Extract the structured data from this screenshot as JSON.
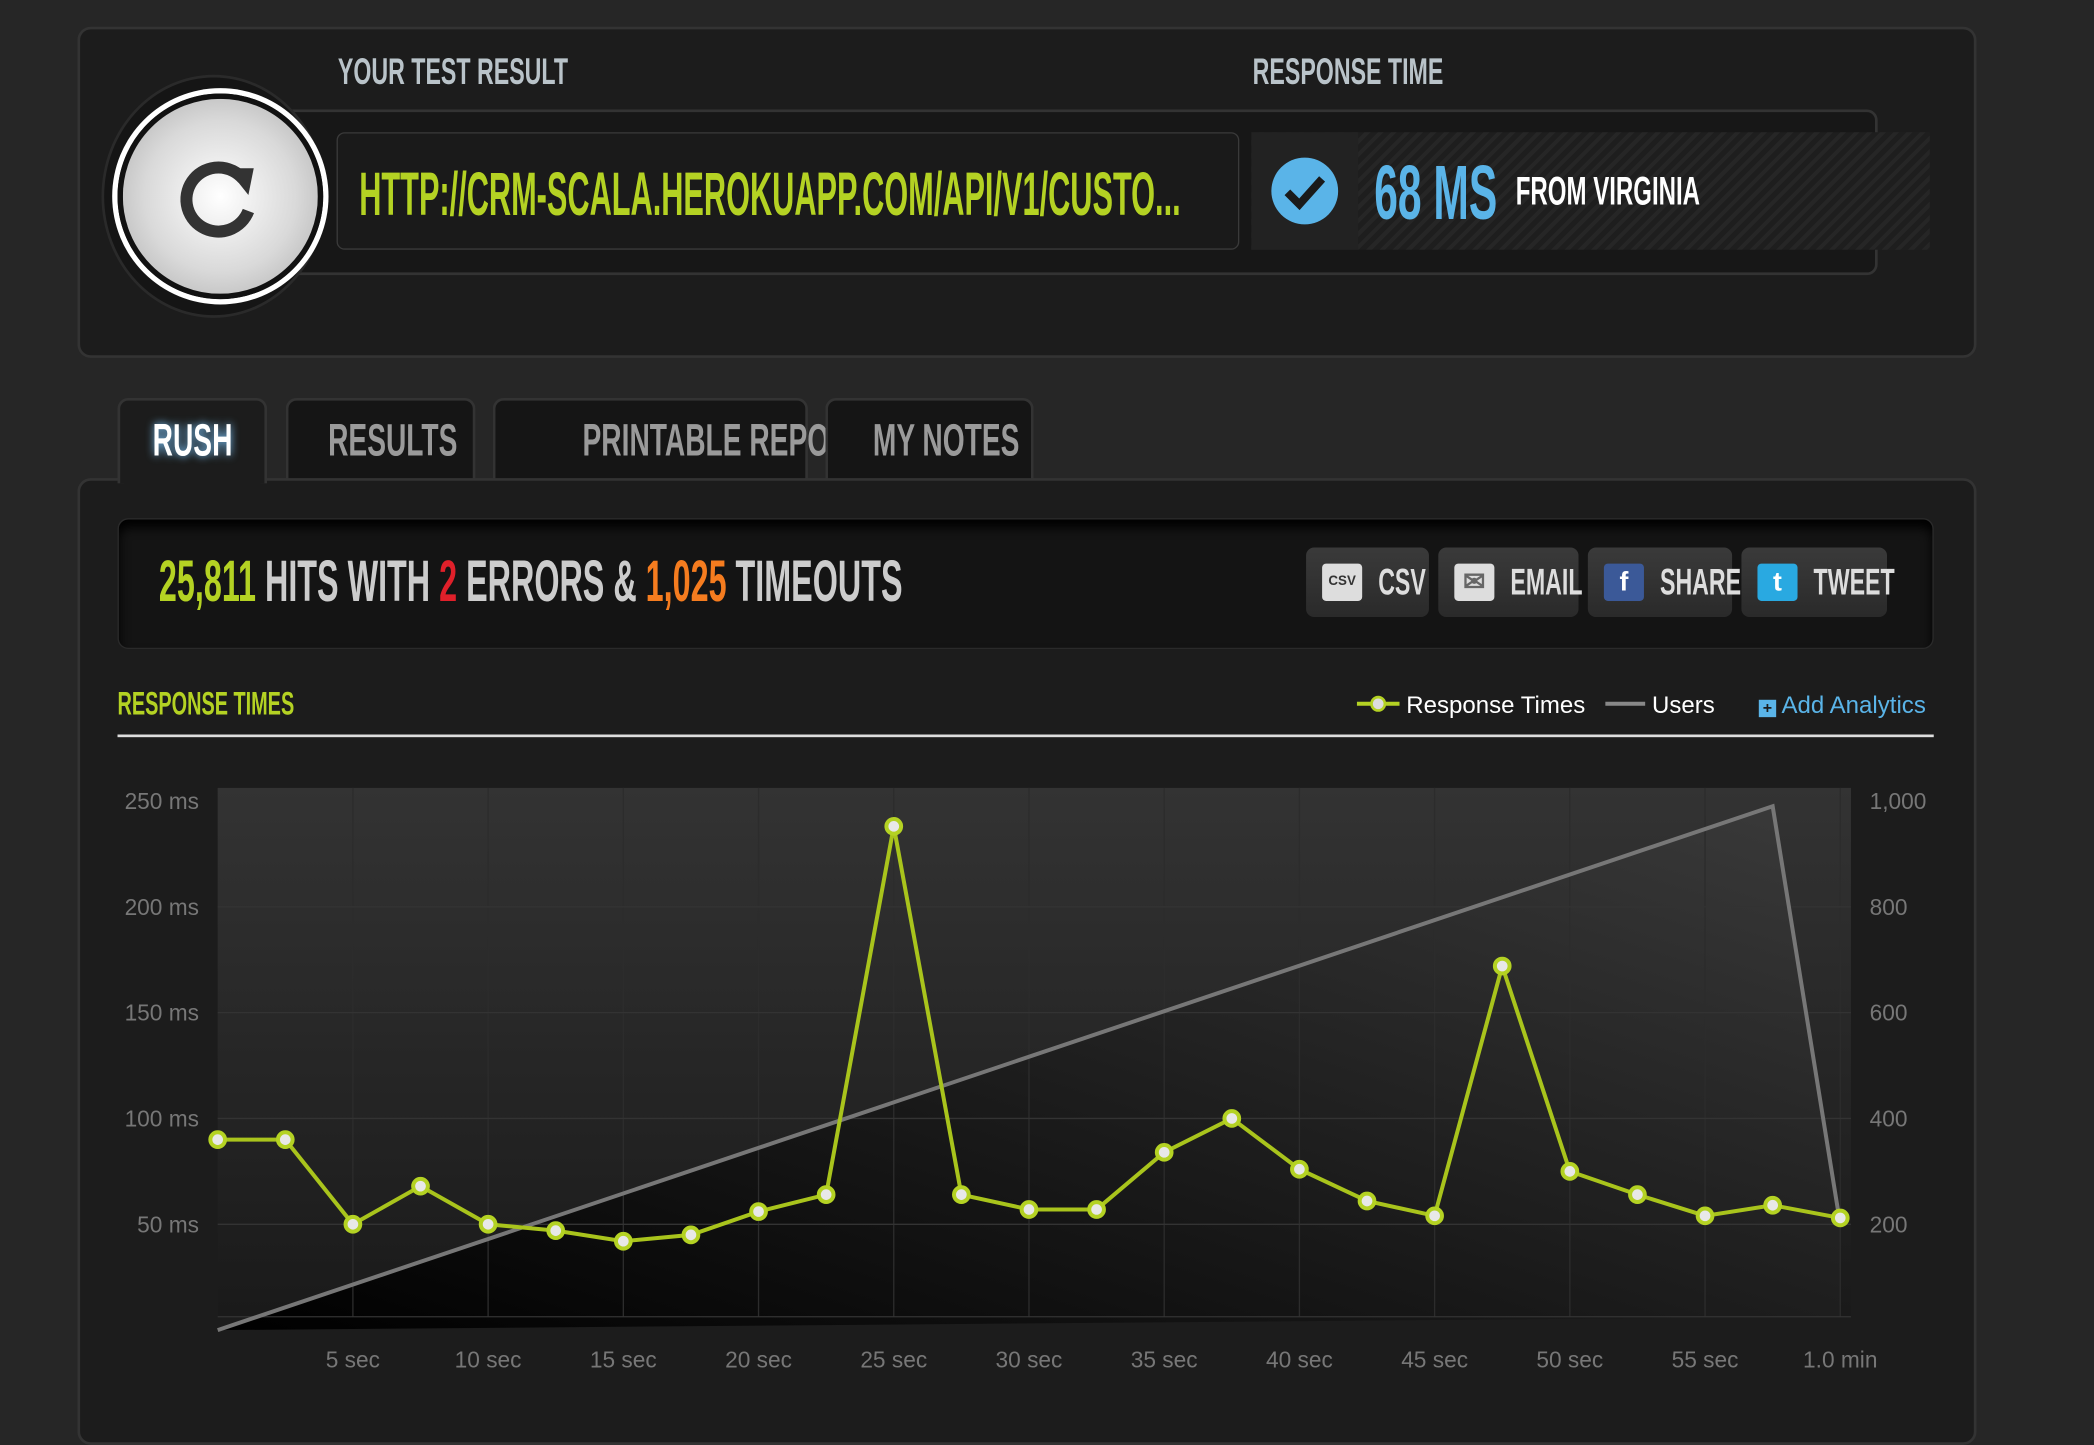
{
  "header": {
    "test_label": "YOUR TEST RESULT",
    "response_label": "RESPONSE TIME",
    "url": "HTTP://CRM-SCALA.HEROKUAPP.COM/API/V1/CUSTO...",
    "response_value": "68 MS",
    "response_location": "FROM VIRGINIA",
    "logo_icon": "refresh-icon",
    "status_icon": "check-circle-icon"
  },
  "tabs": [
    {
      "label": "RUSH",
      "active": true
    },
    {
      "label": "RESULTS"
    },
    {
      "label": "PRINTABLE REPORT"
    },
    {
      "label": "MY NOTES"
    }
  ],
  "summary": {
    "hits": "25,811",
    "hits_text": "HITS WITH",
    "errors": "2",
    "errors_text": "ERRORS &",
    "timeouts": "1,025",
    "timeouts_text": "TIMEOUTS"
  },
  "share_buttons": [
    {
      "label": "CSV",
      "icon": "csv-icon"
    },
    {
      "label": "EMAIL",
      "icon": "email-icon"
    },
    {
      "label": "SHARE",
      "icon": "facebook-icon"
    },
    {
      "label": "TWEET",
      "icon": "twitter-icon"
    }
  ],
  "colors": {
    "accent": "#b4d223",
    "error": "#e0202a",
    "timeout": "#f57c1f",
    "blue": "#5ab4e8"
  },
  "chart_data": {
    "type": "line",
    "title": "RESPONSE TIMES",
    "legend": [
      "Response Times",
      "Users"
    ],
    "legend_placement": "top-right",
    "add_analytics": "Add Analytics",
    "x_ticks": [
      "5 sec",
      "10 sec",
      "15 sec",
      "20 sec",
      "25 sec",
      "30 sec",
      "35 sec",
      "40 sec",
      "45 sec",
      "50 sec",
      "55 sec",
      "1.0 min"
    ],
    "y_ticks": [
      "250 ms",
      "200 ms",
      "150 ms",
      "100 ms",
      "50 ms"
    ],
    "y2_ticks": [
      "1,000",
      "800",
      "600",
      "400",
      "200"
    ],
    "xlim": [
      0,
      60
    ],
    "ylim": [
      0,
      250
    ],
    "y2lim": [
      0,
      1000
    ],
    "grid": true,
    "series": [
      {
        "name": "Response Times",
        "axis": "left",
        "x": [
          0,
          2.5,
          5,
          7.5,
          10,
          12.5,
          15,
          17.5,
          20,
          22.5,
          25,
          27.5,
          30,
          32.5,
          35,
          37.5,
          40,
          42.5,
          45,
          47.5,
          50,
          52.5,
          55,
          57.5,
          60
        ],
        "values": [
          90,
          90,
          50,
          68,
          50,
          47,
          42,
          45,
          56,
          64,
          238,
          64,
          57,
          57,
          84,
          100,
          76,
          61,
          54,
          172,
          75,
          64,
          54,
          59,
          53
        ]
      },
      {
        "name": "Users",
        "axis": "right",
        "x": [
          0,
          57.5,
          60
        ],
        "values": [
          0,
          990,
          200
        ]
      }
    ]
  }
}
